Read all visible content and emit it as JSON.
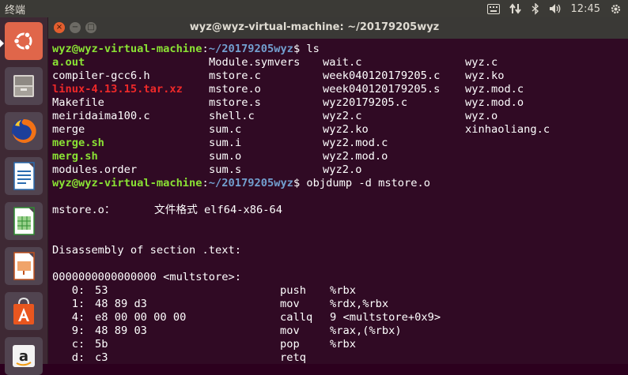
{
  "topbar": {
    "app_name": "终端",
    "time": "12:45",
    "indicators": [
      "keyboard-icon",
      "network-updown-icon",
      "bluetooth-icon",
      "volume-icon",
      "power-gear-icon"
    ]
  },
  "launcher": {
    "items": [
      "ubuntu-dash",
      "files",
      "firefox",
      "libreoffice-writer",
      "libreoffice-calc",
      "libreoffice-impress",
      "software-center",
      "amazon"
    ]
  },
  "window": {
    "title": "wyz@wyz-virtual-machine: ~/20179205wyz",
    "close": "×",
    "minimize": "−",
    "maximize": "□"
  },
  "terminal": {
    "prompt_user_host": "wyz@wyz-virtual-machine",
    "prompt_colon": ":",
    "prompt_path": "~/20179205wyz",
    "prompt_symbol": "$",
    "cmd_ls": " ls",
    "cmd_objdump": " objdump -d mstore.o",
    "ls_rows": [
      [
        {
          "t": "a.out",
          "c": "g"
        },
        {
          "t": "Module.symvers",
          "c": "w"
        },
        {
          "t": "wait.c",
          "c": "w"
        },
        {
          "t": "wyz.c",
          "c": "w"
        }
      ],
      [
        {
          "t": "compiler-gcc6.h",
          "c": "w"
        },
        {
          "t": "mstore.c",
          "c": "w"
        },
        {
          "t": "week040120179205.c",
          "c": "w"
        },
        {
          "t": "wyz.ko",
          "c": "w"
        }
      ],
      [
        {
          "t": "linux-4.13.15.tar.xz",
          "c": "r"
        },
        {
          "t": "mstore.o",
          "c": "w"
        },
        {
          "t": "week040120179205.s",
          "c": "w"
        },
        {
          "t": "wyz.mod.c",
          "c": "w"
        }
      ],
      [
        {
          "t": "Makefile",
          "c": "w"
        },
        {
          "t": "mstore.s",
          "c": "w"
        },
        {
          "t": "wyz20179205.c",
          "c": "w"
        },
        {
          "t": "wyz.mod.o",
          "c": "w"
        }
      ],
      [
        {
          "t": "meiridaima100.c",
          "c": "w"
        },
        {
          "t": "shell.c",
          "c": "w"
        },
        {
          "t": "wyz2.c",
          "c": "w"
        },
        {
          "t": "wyz.o",
          "c": "w"
        }
      ],
      [
        {
          "t": "merge",
          "c": "w"
        },
        {
          "t": "sum.c",
          "c": "w"
        },
        {
          "t": "wyz2.ko",
          "c": "w"
        },
        {
          "t": "xinhaoliang.c",
          "c": "w"
        }
      ],
      [
        {
          "t": "merge.sh",
          "c": "g"
        },
        {
          "t": "sum.i",
          "c": "w"
        },
        {
          "t": "wyz2.mod.c",
          "c": "w"
        },
        {
          "t": "",
          "c": "w"
        }
      ],
      [
        {
          "t": "merg.sh",
          "c": "g"
        },
        {
          "t": "sum.o",
          "c": "w"
        },
        {
          "t": "wyz2.mod.o",
          "c": "w"
        },
        {
          "t": "",
          "c": "w"
        }
      ],
      [
        {
          "t": "modules.order",
          "c": "w"
        },
        {
          "t": "sum.s",
          "c": "w"
        },
        {
          "t": "wyz2.o",
          "c": "w"
        },
        {
          "t": "",
          "c": "w"
        }
      ]
    ],
    "file_format_line": "mstore.o：      文件格式 elf64-x86-64",
    "section_line": "Disassembly of section .text:",
    "symbol_line": "0000000000000000 <multstore>:",
    "asm_rows": [
      {
        "addr": "   0:",
        "bytes": "53",
        "op": "push",
        "args": "%rbx"
      },
      {
        "addr": "   1:",
        "bytes": "48 89 d3",
        "op": "mov",
        "args": "%rdx,%rbx"
      },
      {
        "addr": "   4:",
        "bytes": "e8 00 00 00 00",
        "op": "callq",
        "args": "9 <multstore+0x9>"
      },
      {
        "addr": "   9:",
        "bytes": "48 89 03",
        "op": "mov",
        "args": "%rax,(%rbx)"
      },
      {
        "addr": "   c:",
        "bytes": "5b",
        "op": "pop",
        "args": "%rbx"
      },
      {
        "addr": "   d:",
        "bytes": "c3",
        "op": "retq",
        "args": ""
      }
    ]
  }
}
